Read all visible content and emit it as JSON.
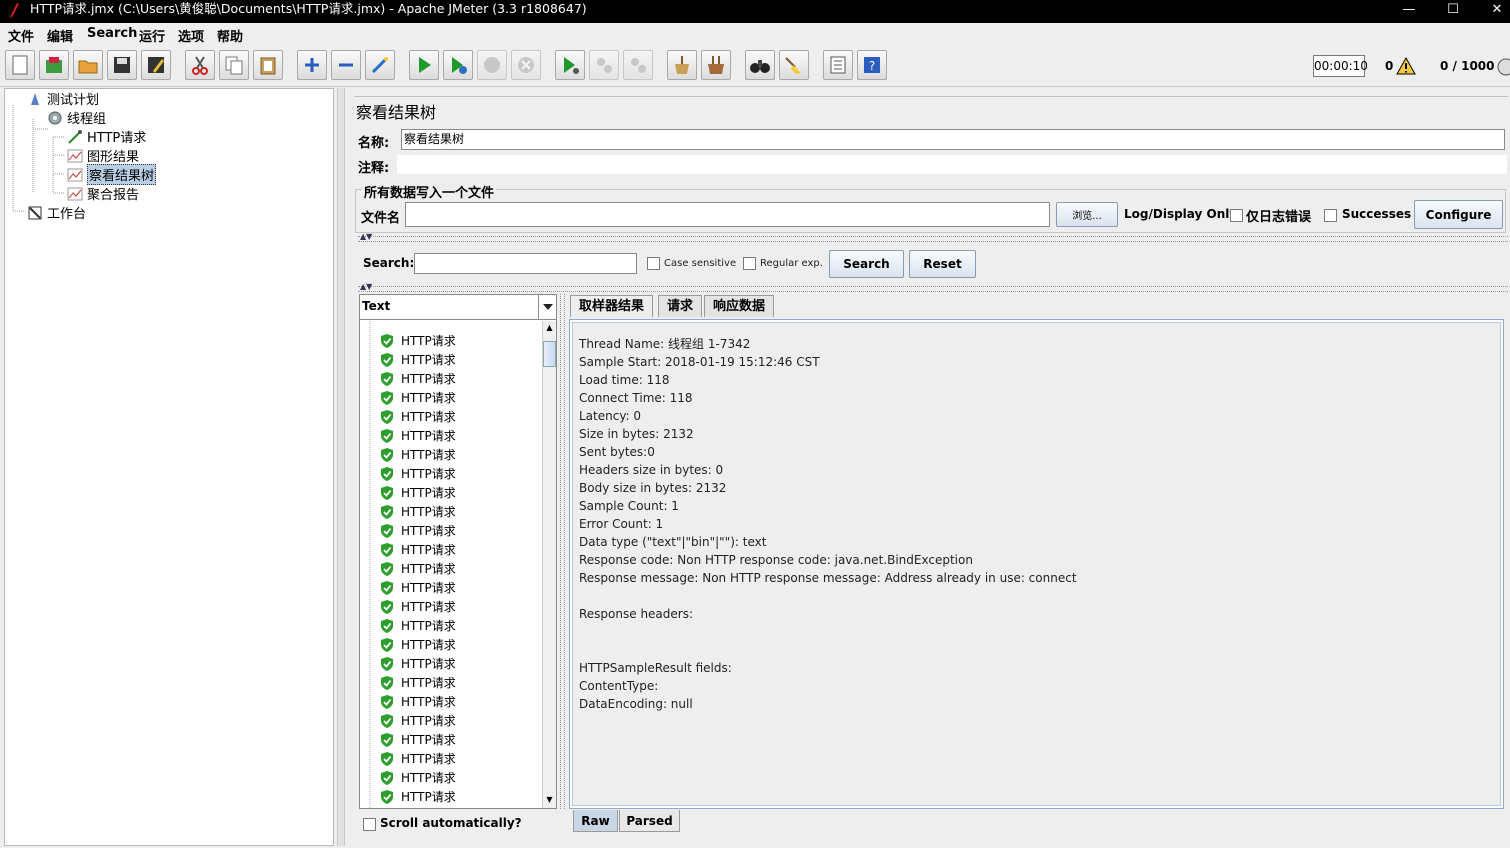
{
  "window": {
    "title": "HTTP请求.jmx (C:\\Users\\黄俊聪\\Documents\\HTTP请求.jmx) - Apache JMeter (3.3 r1808647)"
  },
  "menu": [
    "文件",
    "编辑",
    "Search",
    "运行",
    "选项",
    "帮助"
  ],
  "status": {
    "timer": "00:00:10",
    "errors": "0",
    "threads": "0 / 1000"
  },
  "tree": {
    "test_plan": "测试计划",
    "thread_group": "线程组",
    "http_request": "HTTP请求",
    "graph_results": "图形结果",
    "view_results_tree": "察看结果树",
    "aggregate_report": "聚合报告",
    "workbench": "工作台"
  },
  "panel": {
    "title": "察看结果树",
    "name_label": "名称:",
    "name_value": "察看结果树",
    "comment_label": "注释:",
    "file_group": "所有数据写入一个文件",
    "filename_label": "文件名",
    "browse_label": "浏览...",
    "log_only_label": "Log/Display Only:",
    "errors_only_label": "仅日志错误",
    "successes_label": "Successes",
    "configure_label": "Configure"
  },
  "search": {
    "label": "Search:",
    "case_sensitive": "Case sensitive",
    "regular_exp": "Regular exp.",
    "search_button": "Search",
    "reset_button": "Reset"
  },
  "renderer": {
    "selected": "Text"
  },
  "results": [
    "HTTP请求",
    "HTTP请求",
    "HTTP请求",
    "HTTP请求",
    "HTTP请求",
    "HTTP请求",
    "HTTP请求",
    "HTTP请求",
    "HTTP请求",
    "HTTP请求",
    "HTTP请求",
    "HTTP请求",
    "HTTP请求",
    "HTTP请求",
    "HTTP请求",
    "HTTP请求",
    "HTTP请求",
    "HTTP请求",
    "HTTP请求",
    "HTTP请求",
    "HTTP请求",
    "HTTP请求",
    "HTTP请求",
    "HTTP请求",
    "HTTP请求"
  ],
  "scroll_auto_label": "Scroll automatically?",
  "tabs": {
    "sampler": "取样器结果",
    "request": "请求",
    "response": "响应数据"
  },
  "sampler_result": [
    "Thread Name: 线程组 1-7342",
    "Sample Start: 2018-01-19 15:12:46 CST",
    "Load time: 118",
    "Connect Time: 118",
    "Latency: 0",
    "Size in bytes: 2132",
    "Sent bytes:0",
    "Headers size in bytes: 0",
    "Body size in bytes: 2132",
    "Sample Count: 1",
    "Error Count: 1",
    "Data type (\"text\"|\"bin\"|\"\"): text",
    "Response code: Non HTTP response code: java.net.BindException",
    "Response message: Non HTTP response message: Address already in use: connect",
    "",
    "Response headers:",
    "",
    "",
    "HTTPSampleResult fields:",
    "ContentType: ",
    "DataEncoding: null"
  ],
  "bottom_tabs": {
    "raw": "Raw",
    "parsed": "Parsed"
  },
  "colors": {
    "selection": "#b8cfe5",
    "success": "#2e9e2e",
    "titlebar": "#000000"
  }
}
